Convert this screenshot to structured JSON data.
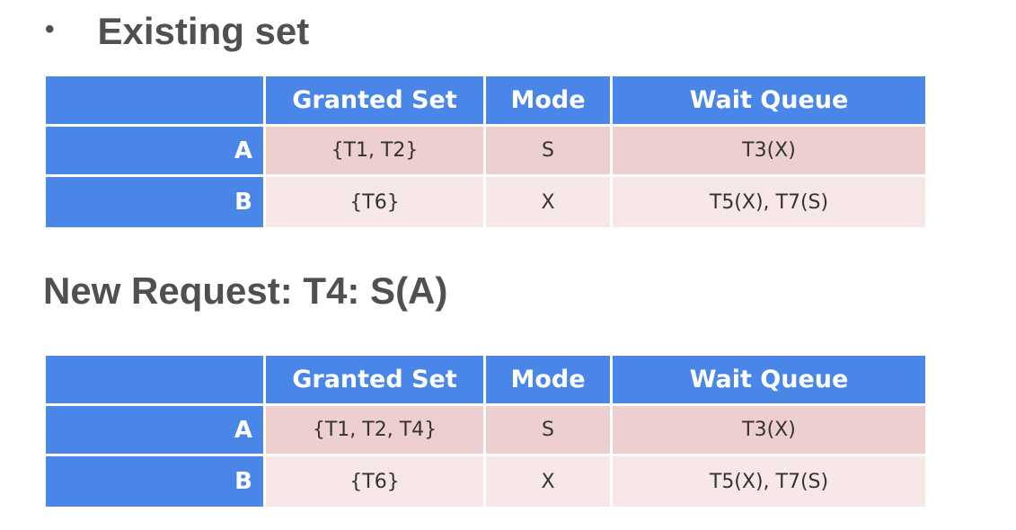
{
  "heading": {
    "bullet": "•",
    "title": "Existing set"
  },
  "columns": {
    "corner": "",
    "granted_set": "Granted Set",
    "mode": "Mode",
    "wait_queue": "Wait Queue"
  },
  "existing_table": {
    "rows": [
      {
        "resource": "A",
        "granted_set": "{T1, T2}",
        "mode": "S",
        "wait_queue": "T3(X)"
      },
      {
        "resource": "B",
        "granted_set": "{T6}",
        "mode": "X",
        "wait_queue": "T5(X), T7(S)"
      }
    ]
  },
  "request": {
    "title": "New Request: T4: S(A)"
  },
  "updated_table": {
    "rows": [
      {
        "resource": "A",
        "granted_set": "{T1, T2, T4}",
        "mode": "S",
        "wait_queue": "T3(X)"
      },
      {
        "resource": "B",
        "granted_set": "{T6}",
        "mode": "X",
        "wait_queue": "T5(X), T7(S)"
      }
    ]
  },
  "colors": {
    "header_blue": "#4a86e8",
    "row_a_fill": "#edcfcf",
    "row_b_fill": "#f7e7e7",
    "title_gray": "#505050"
  }
}
